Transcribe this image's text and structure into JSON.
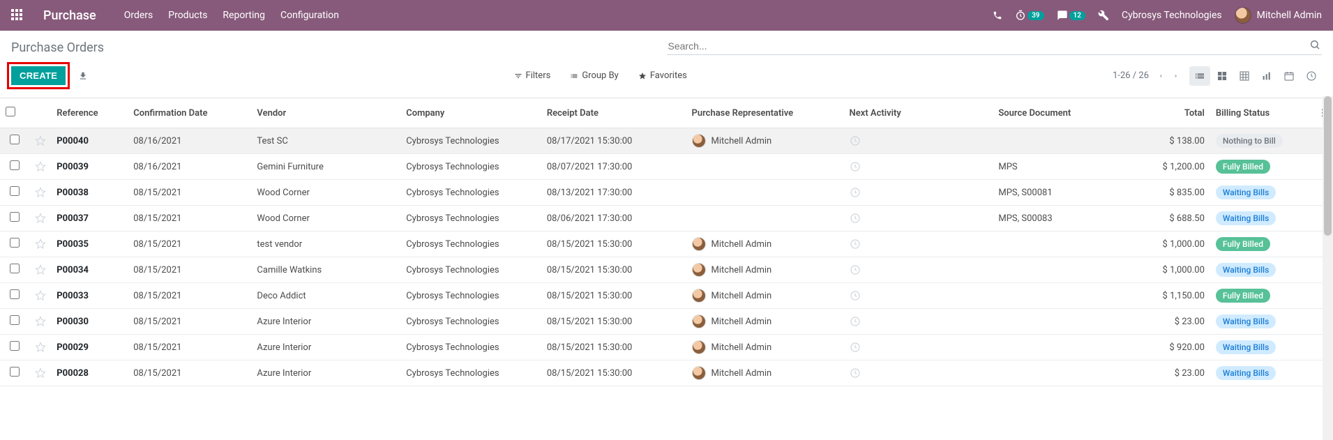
{
  "navbar": {
    "brand": "Purchase",
    "menu": [
      "Orders",
      "Products",
      "Reporting",
      "Configuration"
    ],
    "badge_timer": "39",
    "badge_chat": "12",
    "company": "Cybrosys Technologies",
    "user": "Mitchell Admin"
  },
  "breadcrumb": "Purchase Orders",
  "search": {
    "placeholder": "Search..."
  },
  "buttons": {
    "create": "CREATE"
  },
  "toolbar": {
    "filters": "Filters",
    "groupby": "Group By",
    "favorites": "Favorites",
    "pager": "1-26 / 26"
  },
  "columns": {
    "reference": "Reference",
    "confirmation": "Confirmation Date",
    "vendor": "Vendor",
    "company": "Company",
    "receipt": "Receipt Date",
    "rep": "Purchase Representative",
    "activity": "Next Activity",
    "source": "Source Document",
    "total": "Total",
    "status": "Billing Status"
  },
  "rows": [
    {
      "ref": "P00040",
      "conf": "08/16/2021",
      "vendor": "Test SC",
      "company": "Cybrosys Technologies",
      "receipt": "08/17/2021 15:30:00",
      "rep": "Mitchell Admin",
      "source": "",
      "total": "$ 138.00",
      "status": "Nothing to Bill",
      "pill": "grey",
      "hovered": true
    },
    {
      "ref": "P00039",
      "conf": "08/16/2021",
      "vendor": "Gemini Furniture",
      "company": "Cybrosys Technologies",
      "receipt": "08/07/2021 17:30:00",
      "rep": "",
      "source": "MPS",
      "total": "$ 1,200.00",
      "status": "Fully Billed",
      "pill": "green"
    },
    {
      "ref": "P00038",
      "conf": "08/15/2021",
      "vendor": "Wood Corner",
      "company": "Cybrosys Technologies",
      "receipt": "08/13/2021 17:30:00",
      "rep": "",
      "source": "MPS, S00081",
      "total": "$ 835.00",
      "status": "Waiting Bills",
      "pill": "blue"
    },
    {
      "ref": "P00037",
      "conf": "08/15/2021",
      "vendor": "Wood Corner",
      "company": "Cybrosys Technologies",
      "receipt": "08/06/2021 17:30:00",
      "rep": "",
      "source": "MPS, S00083",
      "total": "$ 688.50",
      "status": "Waiting Bills",
      "pill": "blue"
    },
    {
      "ref": "P00035",
      "conf": "08/15/2021",
      "vendor": "test vendor",
      "company": "Cybrosys Technologies",
      "receipt": "08/15/2021 15:30:00",
      "rep": "Mitchell Admin",
      "source": "",
      "total": "$ 1,000.00",
      "status": "Fully Billed",
      "pill": "green"
    },
    {
      "ref": "P00034",
      "conf": "08/15/2021",
      "vendor": "Camille Watkins",
      "company": "Cybrosys Technologies",
      "receipt": "08/15/2021 15:30:00",
      "rep": "Mitchell Admin",
      "source": "",
      "total": "$ 1,000.00",
      "status": "Waiting Bills",
      "pill": "blue"
    },
    {
      "ref": "P00033",
      "conf": "08/15/2021",
      "vendor": "Deco Addict",
      "company": "Cybrosys Technologies",
      "receipt": "08/15/2021 15:30:00",
      "rep": "Mitchell Admin",
      "source": "",
      "total": "$ 1,150.00",
      "status": "Fully Billed",
      "pill": "green"
    },
    {
      "ref": "P00030",
      "conf": "08/15/2021",
      "vendor": "Azure Interior",
      "company": "Cybrosys Technologies",
      "receipt": "08/15/2021 15:30:00",
      "rep": "Mitchell Admin",
      "source": "",
      "total": "$ 23.00",
      "status": "Waiting Bills",
      "pill": "blue"
    },
    {
      "ref": "P00029",
      "conf": "08/15/2021",
      "vendor": "Azure Interior",
      "company": "Cybrosys Technologies",
      "receipt": "08/15/2021 15:30:00",
      "rep": "Mitchell Admin",
      "source": "",
      "total": "$ 920.00",
      "status": "Waiting Bills",
      "pill": "blue"
    },
    {
      "ref": "P00028",
      "conf": "08/15/2021",
      "vendor": "Azure Interior",
      "company": "Cybrosys Technologies",
      "receipt": "08/15/2021 15:30:00",
      "rep": "Mitchell Admin",
      "source": "",
      "total": "$ 23.00",
      "status": "Waiting Bills",
      "pill": "blue"
    }
  ]
}
